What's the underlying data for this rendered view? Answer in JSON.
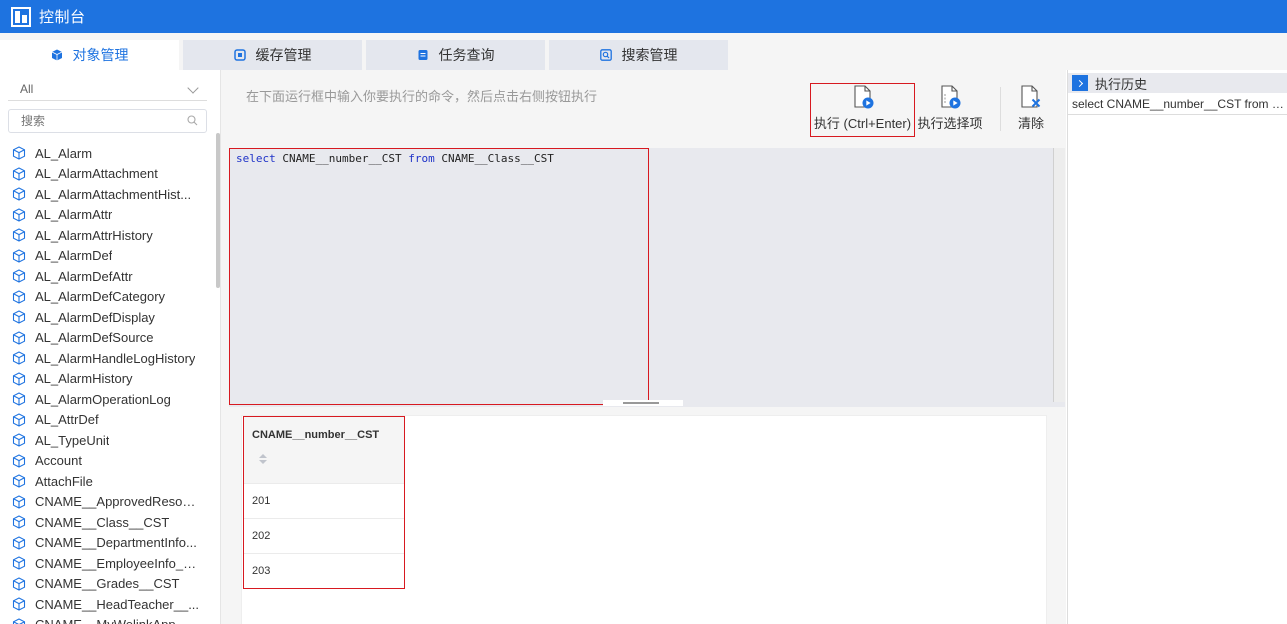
{
  "app": {
    "title": "控制台",
    "accent": "#1e73e0"
  },
  "tabs": [
    {
      "label": "对象管理",
      "icon": "cube-icon",
      "active": true
    },
    {
      "label": "缓存管理",
      "icon": "cache-icon",
      "active": false
    },
    {
      "label": "任务查询",
      "icon": "task-icon",
      "active": false
    },
    {
      "label": "搜索管理",
      "icon": "search-manage-icon",
      "active": false
    }
  ],
  "left": {
    "filter_value": "All",
    "search_placeholder": "搜索",
    "items": [
      "AL_Alarm",
      "AL_AlarmAttachment",
      "AL_AlarmAttachmentHist...",
      "AL_AlarmAttr",
      "AL_AlarmAttrHistory",
      "AL_AlarmDef",
      "AL_AlarmDefAttr",
      "AL_AlarmDefCategory",
      "AL_AlarmDefDisplay",
      "AL_AlarmDefSource",
      "AL_AlarmHandleLogHistory",
      "AL_AlarmHistory",
      "AL_AlarmOperationLog",
      "AL_AttrDef",
      "AL_TypeUnit",
      "Account",
      "AttachFile",
      "CNAME__ApprovedResou...",
      "CNAME__Class__CST",
      "CNAME__DepartmentInfo...",
      "CNAME__EmployeeInfo__...",
      "CNAME__Grades__CST",
      "CNAME__HeadTeacher__...",
      "CNAME__MyWelinkApp..."
    ]
  },
  "center": {
    "hint": "在下面运行框中输入你要执行的命令，然后点击右侧按钮执行",
    "run_label": "执行 (Ctrl+Enter)",
    "run_selected_label": "执行选择项",
    "clear_label": "清除",
    "query": {
      "kw1": "select",
      "part1": " CNAME__number__CST ",
      "kw2": "from",
      "part2": " CNAME__Class__CST"
    },
    "result": {
      "column": "CNAME__number__CST",
      "rows": [
        "201",
        "202",
        "203"
      ]
    }
  },
  "history": {
    "title": "执行历史",
    "items": [
      "select CNAME__number__CST from CNAME__Class__CST"
    ]
  }
}
